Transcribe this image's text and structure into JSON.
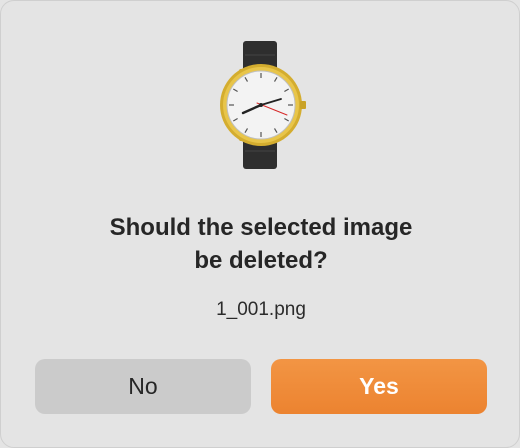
{
  "dialog": {
    "icon": "wristwatch-icon",
    "message_line1": "Should the selected image",
    "message_line2": "be deleted?",
    "filename": "1_001.png",
    "no_label": "No",
    "yes_label": "Yes",
    "accent_color": "#ef8b36"
  }
}
